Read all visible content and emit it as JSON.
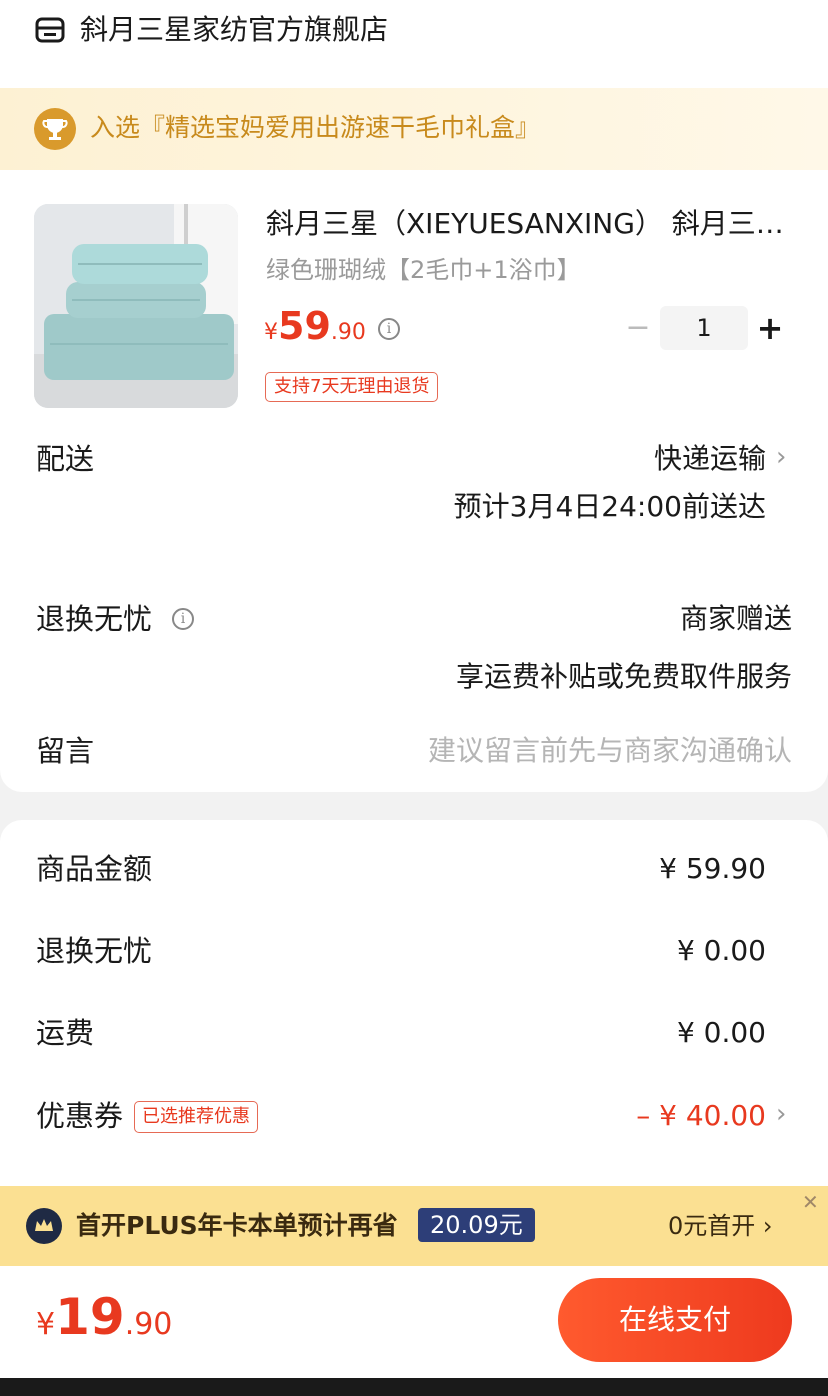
{
  "store": {
    "name": "斜月三星家纺官方旗舰店",
    "icon": "store-icon"
  },
  "promo": {
    "text": "入选『精选宝妈爱用出游速干毛巾礼盒』",
    "icon": "trophy-icon"
  },
  "product": {
    "title": "斜月三星（XIEYUESANXING） 斜月三星毛巾浴巾套装",
    "spec": "绿色珊瑚绒【2毛巾+1浴巾】",
    "price_currency": "¥",
    "price_int": "59",
    "price_dec": ".90",
    "quantity": "1",
    "minus": "−",
    "plus": "+",
    "return_tag": "支持7天无理由退货",
    "thumb_color": "#9fc9c9"
  },
  "delivery": {
    "label": "配送",
    "method": "快递运输",
    "eta": "预计3月4日24:00前送达"
  },
  "return_service": {
    "label": "退换无忧",
    "value": "商家赠送",
    "desc": "享运费补贴或免费取件服务"
  },
  "message": {
    "label": "留言",
    "placeholder": "建议留言前先与商家沟通确认"
  },
  "summary": {
    "goods_label": "商品金额",
    "goods_value": "¥ 59.90",
    "return_label": "退换无忧",
    "return_value": "¥ 0.00",
    "shipping_label": "运费",
    "shipping_value": "¥ 0.00",
    "coupon_label": "优惠券",
    "coupon_tag": "已选推荐优惠",
    "coupon_value": "– ¥ 40.00"
  },
  "plus": {
    "text": "首开PLUS年卡本单预计再省",
    "badge": "20.09元",
    "cta": "0元首开 ›",
    "close": "✕"
  },
  "checkout": {
    "total_currency": "¥",
    "total_int": "19",
    "total_dec": ".90",
    "pay_label": "在线支付"
  },
  "colors": {
    "accent": "#e8391f",
    "gold": "#c88a1c",
    "plus_bg": "#fbe092",
    "plus_badge": "#2d3e78"
  }
}
